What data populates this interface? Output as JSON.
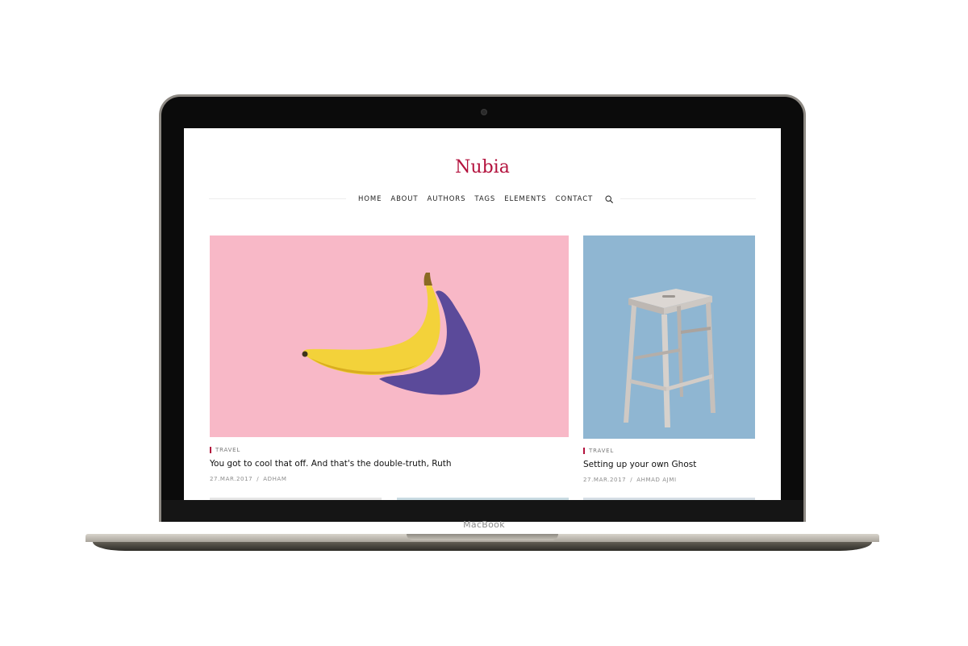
{
  "device": {
    "brand_label": "MacBook"
  },
  "site": {
    "title": "Nubia",
    "accent_color": "#b3123d",
    "nav": [
      {
        "label": "HOME"
      },
      {
        "label": "ABOUT"
      },
      {
        "label": "AUTHORS"
      },
      {
        "label": "TAGS"
      },
      {
        "label": "ELEMENTS"
      },
      {
        "label": "CONTACT"
      }
    ],
    "search_icon": "search-icon"
  },
  "posts": [
    {
      "tag": "TRAVEL",
      "title": "You got to cool that off. And that's the double-truth, Ruth",
      "date": "27.MAR.2017",
      "separator": "/",
      "author": "ADHAM",
      "image": "banana-on-pink-background"
    },
    {
      "tag": "TRAVEL",
      "title": "Setting up your own Ghost",
      "date": "27.MAR.2017",
      "separator": "/",
      "author": "AHMAD AJMI",
      "image": "wooden-stool-on-blue-background"
    }
  ]
}
